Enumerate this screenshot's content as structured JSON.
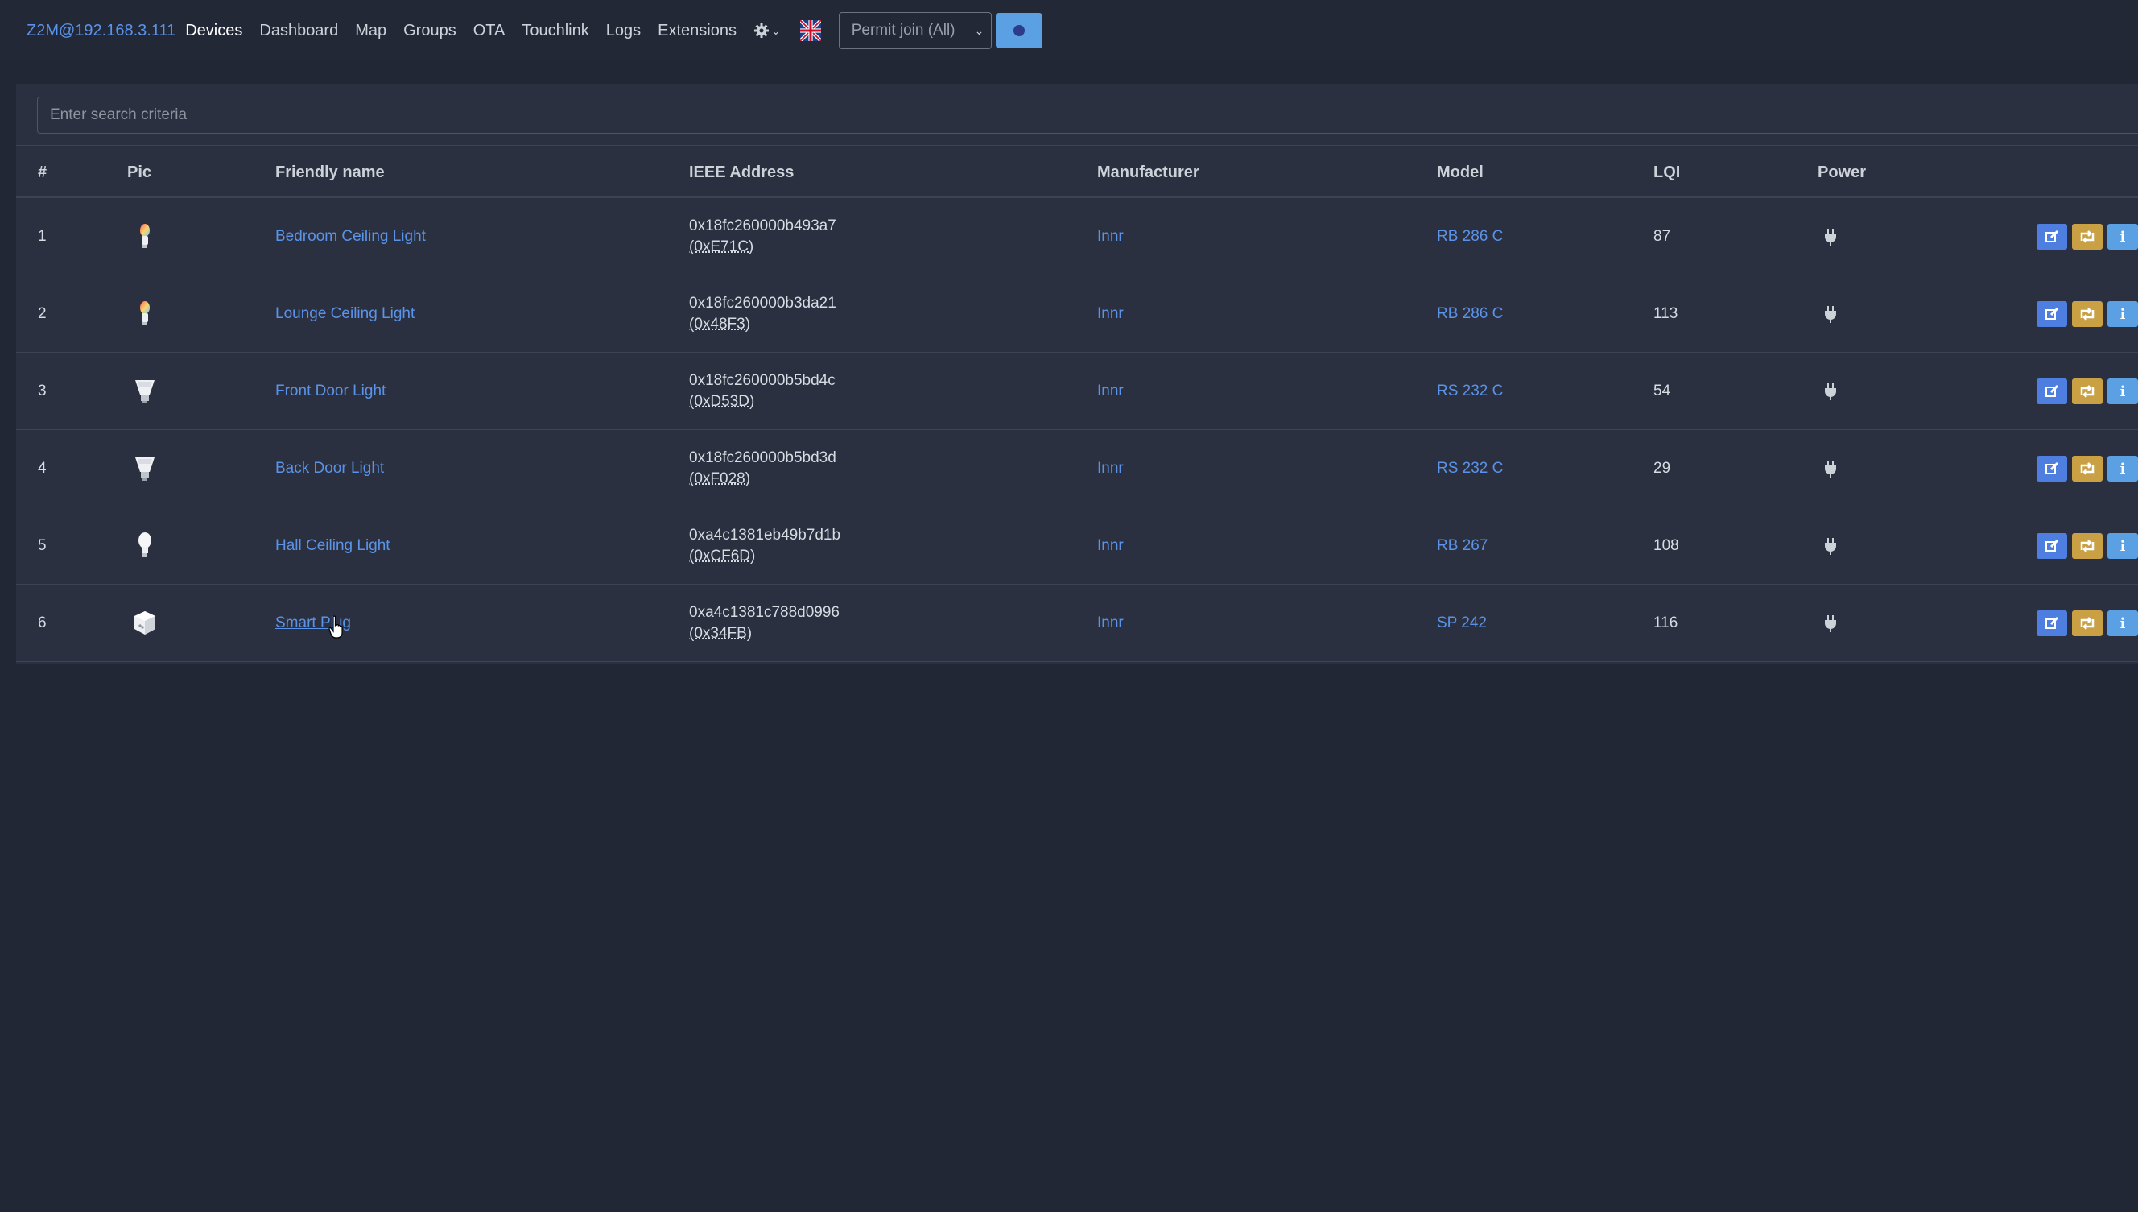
{
  "navbar": {
    "brand": "Z2M@192.168.3.111",
    "links": [
      "Devices",
      "Dashboard",
      "Map",
      "Groups",
      "OTA",
      "Touchlink",
      "Logs",
      "Extensions"
    ],
    "active_link": "Devices",
    "settings_icon": "gear-icon",
    "language_icon": "uk-flag-icon",
    "permit_join_label": "Permit join (All)"
  },
  "search": {
    "placeholder": "Enter search criteria"
  },
  "table": {
    "headers": [
      "#",
      "Pic",
      "Friendly name",
      "IEEE Address",
      "Manufacturer",
      "Model",
      "LQI",
      "Power"
    ],
    "rows": [
      {
        "num": "1",
        "pic": "bulb-color-icon",
        "name": "Bedroom Ceiling Light",
        "ieee": "0x18fc260000b493a7",
        "nwk": "(0xE71C)",
        "manufacturer": "Innr",
        "model": "RB 286 C",
        "lqi": "87",
        "power": "plug-icon"
      },
      {
        "num": "2",
        "pic": "bulb-color-icon",
        "name": "Lounge Ceiling Light",
        "ieee": "0x18fc260000b3da21",
        "nwk": "(0x48F3)",
        "manufacturer": "Innr",
        "model": "RB 286 C",
        "lqi": "113",
        "power": "plug-icon"
      },
      {
        "num": "3",
        "pic": "spot-bulb-icon",
        "name": "Front Door Light",
        "ieee": "0x18fc260000b5bd4c",
        "nwk": "(0xD53D)",
        "manufacturer": "Innr",
        "model": "RS 232 C",
        "lqi": "54",
        "power": "plug-icon"
      },
      {
        "num": "4",
        "pic": "spot-bulb-icon",
        "name": "Back Door Light",
        "ieee": "0x18fc260000b5bd3d",
        "nwk": "(0xF028)",
        "manufacturer": "Innr",
        "model": "RS 232 C",
        "lqi": "29",
        "power": "plug-icon"
      },
      {
        "num": "5",
        "pic": "bulb-white-icon",
        "name": "Hall Ceiling Light",
        "ieee": "0xa4c1381eb49b7d1b",
        "nwk": "(0xCF6D)",
        "manufacturer": "Innr",
        "model": "RB 267",
        "lqi": "108",
        "power": "plug-icon"
      },
      {
        "num": "6",
        "pic": "smart-plug-icon",
        "name": "Smart Plug",
        "ieee": "0xa4c1381c788d0996",
        "nwk": "(0x34FB)",
        "manufacturer": "Innr",
        "model": "SP 242",
        "lqi": "116",
        "power": "plug-icon"
      }
    ]
  },
  "colors": {
    "background": "#222735",
    "card": "#2b3041",
    "link": "#5a93e8",
    "edit_button": "#4e7fe0",
    "rename_button": "#c9a044",
    "info_button": "#5aa0e2",
    "remove_button": "#d9534f"
  }
}
